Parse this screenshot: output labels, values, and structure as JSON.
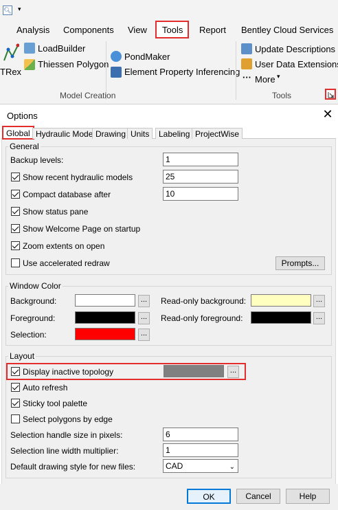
{
  "ribbon": {
    "qat_dropdown": "▾",
    "tabs": [
      "Analysis",
      "Components",
      "View",
      "Tools",
      "Report",
      "Bentley Cloud Services"
    ],
    "model_creation": {
      "trex": "TRex",
      "loadbuilder": "LoadBuilder",
      "thiessen": "Thiessen Polygon",
      "pondmaker": "PondMaker",
      "epi": "Element Property Inferencing",
      "group_label": "Model Creation"
    },
    "tools": {
      "update_descriptions": "Update Descriptions",
      "user_data_extensions": "User Data Extensions",
      "more": "More",
      "more_caret": "▾",
      "more_dots": "···",
      "group_label": "Tools"
    }
  },
  "dialog": {
    "title": "Options",
    "close": "✕",
    "tabs": [
      "Global",
      "Hydraulic Model",
      "Drawing",
      "Units",
      "Labeling",
      "ProjectWise"
    ],
    "general": {
      "label": "General",
      "backup_levels_label": "Backup levels:",
      "backup_levels_value": "1",
      "show_recent_label": "Show recent hydraulic models",
      "show_recent_value": "25",
      "compact_label": "Compact database after",
      "compact_value": "10",
      "status_pane_label": "Show status pane",
      "welcome_label": "Show Welcome Page on startup",
      "zoom_label": "Zoom extents on open",
      "accel_label": "Use accelerated redraw",
      "prompts_label": "Prompts..."
    },
    "window_color": {
      "label": "Window Color",
      "background_label": "Background:",
      "foreground_label": "Foreground:",
      "selection_label": "Selection:",
      "ro_background_label": "Read-only background:",
      "ro_foreground_label": "Read-only foreground:",
      "dots": "...",
      "colors": {
        "background": "#ffffff",
        "foreground": "#000000",
        "selection": "#ff0000",
        "ro_background": "#ffffc0",
        "ro_foreground": "#000000"
      }
    },
    "layout": {
      "label": "Layout",
      "inactive_label": "Display inactive topology",
      "inactive_color": "#808080",
      "auto_refresh_label": "Auto refresh",
      "sticky_label": "Sticky tool palette",
      "select_polygons_label": "Select polygons by edge",
      "handle_size_label": "Selection handle size in pixels:",
      "handle_size_value": "6",
      "line_width_label": "Selection line width multiplier:",
      "line_width_value": "1",
      "drawing_style_label": "Default drawing style for new files:",
      "drawing_style_value": "CAD"
    },
    "buttons": {
      "ok": "OK",
      "cancel": "Cancel",
      "help": "Help"
    }
  }
}
